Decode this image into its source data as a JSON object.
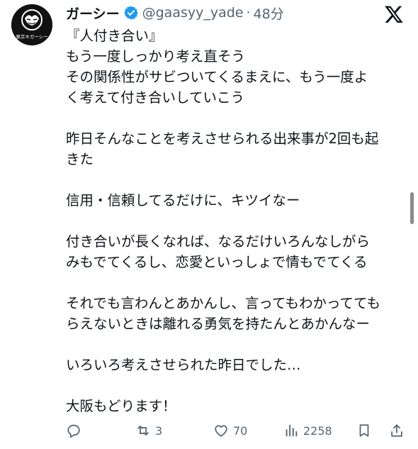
{
  "author": {
    "display_name": "ガーシー",
    "handle": "@gaasyy_yade",
    "separator": "·",
    "time": "48分",
    "avatar_text": "東京キガーシー"
  },
  "tweet": {
    "lines": [
      "『人付き合い』",
      "もう一度しっかり考え直そう",
      "その関係性がサビついてくるまえに、もう一度よ",
      "く考えて付き合いしていこう",
      "",
      "昨日そんなことを考えさせられる出来事が2回も起",
      "きた",
      "",
      "信用・信頼してるだけに、キツイなー",
      "",
      "付き合いが長くなれば、なるだけいろんなしがら",
      "みもでてくるし、恋愛といっしょで情もでてくる",
      "",
      "それでも言わんとあかんし、言ってもわかってても",
      "らえないときは離れる勇気を持たんとあかんなー",
      "",
      "いろいろ考えさせられた昨日でした…",
      "",
      "大阪もどります！"
    ]
  },
  "actions": {
    "reply_icon": "reply-icon",
    "retweet_count": "3",
    "like_count": "70",
    "views_count": "2258",
    "bookmark_icon": "bookmark-icon",
    "share_icon": "share-icon"
  },
  "colors": {
    "text": "#0f1419",
    "secondary": "#536471",
    "verified": "#1d9bf0"
  }
}
